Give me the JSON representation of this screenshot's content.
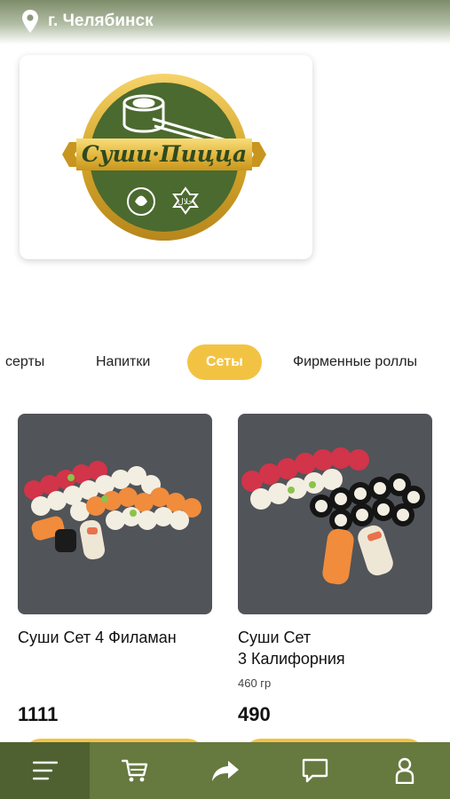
{
  "header": {
    "city": "г. Челябинск"
  },
  "logo": {
    "brand_text": "Суши·Пицца",
    "halal_text": "حلال"
  },
  "categories": [
    {
      "label": "серты",
      "active": false
    },
    {
      "label": "Напитки",
      "active": false
    },
    {
      "label": "Сеты",
      "active": true
    },
    {
      "label": "Фирменные роллы",
      "active": false
    }
  ],
  "products": [
    {
      "name": "Суши Сет 4 Филаман",
      "weight": "",
      "price": "1111"
    },
    {
      "name": "Суши Сет\n3 Калифорния",
      "weight": "460 гр",
      "price": "490"
    }
  ],
  "bottom_nav": [
    {
      "icon": "menu-icon",
      "active": true
    },
    {
      "icon": "cart-icon",
      "active": false
    },
    {
      "icon": "share-icon",
      "active": false
    },
    {
      "icon": "chat-icon",
      "active": false
    },
    {
      "icon": "user-icon",
      "active": false
    }
  ],
  "colors": {
    "accent": "#f2c343",
    "nav_bg": "#66793e",
    "nav_active": "#4f6130",
    "logo_green": "#4b6a2f",
    "logo_gold": "#d4a62a"
  }
}
